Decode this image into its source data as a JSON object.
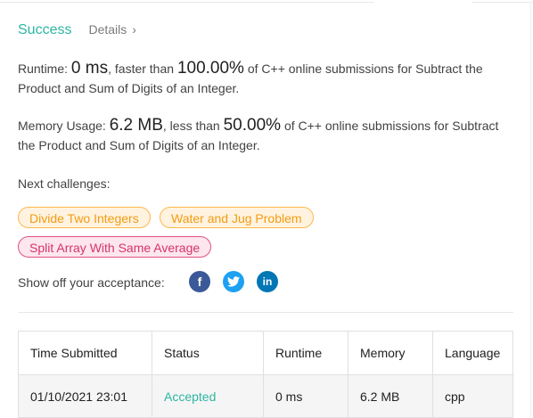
{
  "header": {
    "status": "Success",
    "details_label": "Details",
    "chevron": "›"
  },
  "runtime": {
    "prefix": "Runtime: ",
    "value": "0 ms",
    "mid": ", faster than ",
    "percent": "100.00%",
    "suffix": " of C++ online submissions for Subtract the Product and Sum of Digits of an Integer."
  },
  "memory": {
    "prefix": "Memory Usage: ",
    "value": "6.2 MB",
    "mid": ", less than ",
    "percent": "50.00%",
    "suffix": " of C++ online submissions for Subtract the Product and Sum of Digits of an Integer."
  },
  "challenges": {
    "label": "Next challenges:",
    "items": [
      {
        "label": "Divide Two Integers",
        "difficulty": "medium"
      },
      {
        "label": "Water and Jug Problem",
        "difficulty": "medium"
      },
      {
        "label": "Split Array With Same Average",
        "difficulty": "hard"
      }
    ]
  },
  "share": {
    "label": "Show off your acceptance:",
    "icons": [
      "facebook-icon",
      "twitter-icon",
      "linkedin-icon"
    ]
  },
  "table": {
    "headers": [
      "Time Submitted",
      "Status",
      "Runtime",
      "Memory",
      "Language"
    ],
    "rows": [
      {
        "time": "01/10/2021 23:01",
        "status": "Accepted",
        "runtime": "0 ms",
        "memory": "6.2 MB",
        "language": "cpp"
      }
    ]
  },
  "colors": {
    "success": "#2db6a3",
    "medium_tag": "#f39c12",
    "hard_tag": "#d6336c",
    "facebook": "#3b5998",
    "twitter": "#1da1f2",
    "linkedin": "#0077b5"
  }
}
